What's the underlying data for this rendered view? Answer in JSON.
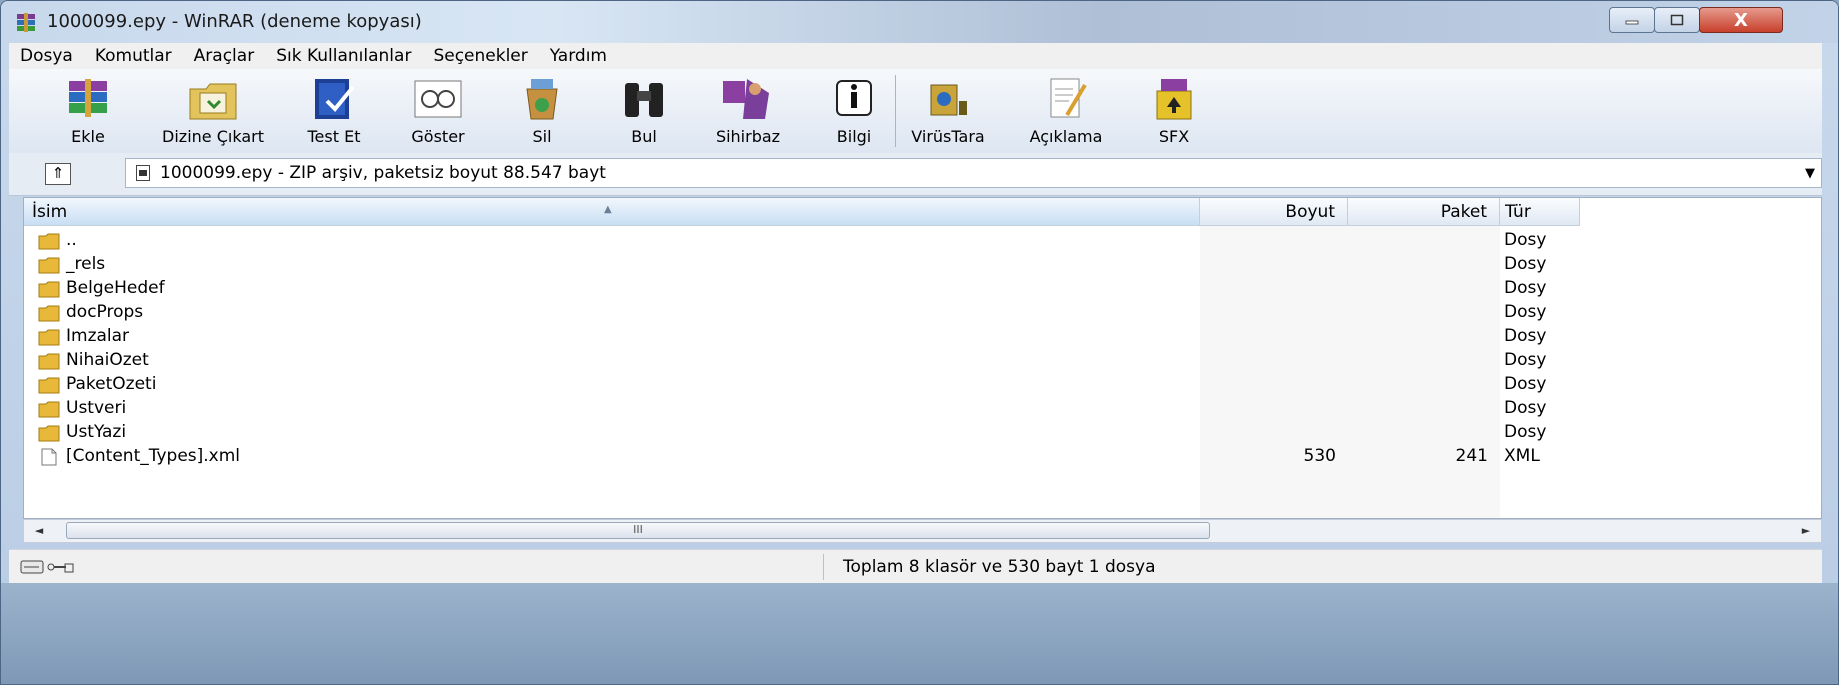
{
  "window": {
    "title": "1000099.epy - WinRAR (deneme kopyası)",
    "caption_buttons": [
      "minimize",
      "maximize",
      "close"
    ],
    "close_glyph": "X"
  },
  "menu": [
    "Dosya",
    "Komutlar",
    "Araçlar",
    "Sık Kullanılanlar",
    "Seçenekler",
    "Yardım"
  ],
  "toolbar": [
    {
      "label": "Ekle",
      "icon": "add-archive-icon"
    },
    {
      "label": "Dizine Çıkart",
      "icon": "extract-to-folder-icon"
    },
    {
      "label": "Test Et",
      "icon": "test-archive-icon"
    },
    {
      "label": "Göster",
      "icon": "view-icon"
    },
    {
      "label": "Sil",
      "icon": "delete-icon"
    },
    {
      "label": "Bul",
      "icon": "find-binoculars-icon"
    },
    {
      "label": "Sihirbaz",
      "icon": "wizard-icon"
    },
    {
      "label": "Bilgi",
      "icon": "info-icon"
    },
    {
      "label": "VirüsTara",
      "icon": "virus-scan-icon"
    },
    {
      "label": "Açıklama",
      "icon": "comment-icon"
    },
    {
      "label": "SFX",
      "icon": "sfx-icon"
    }
  ],
  "address": {
    "up_glyph": "⇑",
    "text": "1000099.epy - ZIP arşiv, paketsiz boyut 88.547 bayt",
    "dropdown_glyph": "▼"
  },
  "columns": {
    "name": "İsim",
    "size": "Boyut",
    "packed": "Paket",
    "type": "Tür"
  },
  "files": [
    {
      "name": "..",
      "size": "",
      "packed": "",
      "type": "Dosy",
      "kind": "folder"
    },
    {
      "name": "_rels",
      "size": "",
      "packed": "",
      "type": "Dosy",
      "kind": "folder"
    },
    {
      "name": "BelgeHedef",
      "size": "",
      "packed": "",
      "type": "Dosy",
      "kind": "folder"
    },
    {
      "name": "docProps",
      "size": "",
      "packed": "",
      "type": "Dosy",
      "kind": "folder"
    },
    {
      "name": "Imzalar",
      "size": "",
      "packed": "",
      "type": "Dosy",
      "kind": "folder"
    },
    {
      "name": "NihaiOzet",
      "size": "",
      "packed": "",
      "type": "Dosy",
      "kind": "folder"
    },
    {
      "name": "PaketOzeti",
      "size": "",
      "packed": "",
      "type": "Dosy",
      "kind": "folder"
    },
    {
      "name": "Ustveri",
      "size": "",
      "packed": "",
      "type": "Dosy",
      "kind": "folder"
    },
    {
      "name": "UstYazi",
      "size": "",
      "packed": "",
      "type": "Dosy",
      "kind": "folder"
    },
    {
      "name": "[Content_Types].xml",
      "size": "530",
      "packed": "241",
      "type": "XML",
      "kind": "file"
    }
  ],
  "scrollbar": {
    "left_glyph": "◄",
    "right_glyph": "►",
    "grip": "III"
  },
  "status": {
    "text": "Toplam 8 klasör ve 530 bayt 1 dosya"
  },
  "colors": {
    "folder": "#e8b83a",
    "title_bar": "#c7d8ec",
    "close_button": "#c8402c"
  }
}
